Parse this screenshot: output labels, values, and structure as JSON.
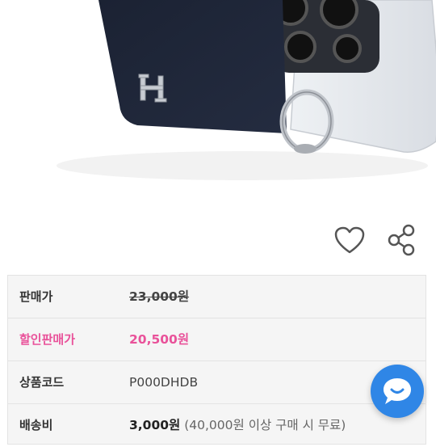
{
  "product_image": {
    "alt": "navy leather card wallet phone case with ring holder"
  },
  "actions": {
    "like_icon": "heart-outline-icon",
    "share_icon": "share-icon"
  },
  "info_table": {
    "rows": [
      {
        "label": "판매가",
        "value": "23,000원"
      },
      {
        "label": "할인판매가",
        "value": "20,500원"
      },
      {
        "label": "상품코드",
        "value": "P000DHDB"
      },
      {
        "label": "배송비",
        "value": "3,000원",
        "note": "(40,000원 이상 구매 시 무료)"
      }
    ]
  },
  "chat_button": {
    "icon": "chat-bubble-icon"
  },
  "colors": {
    "accent_pink": "#e9529a",
    "chat_blue": "#2f86e6",
    "table_bg": "#f5f5f5"
  }
}
